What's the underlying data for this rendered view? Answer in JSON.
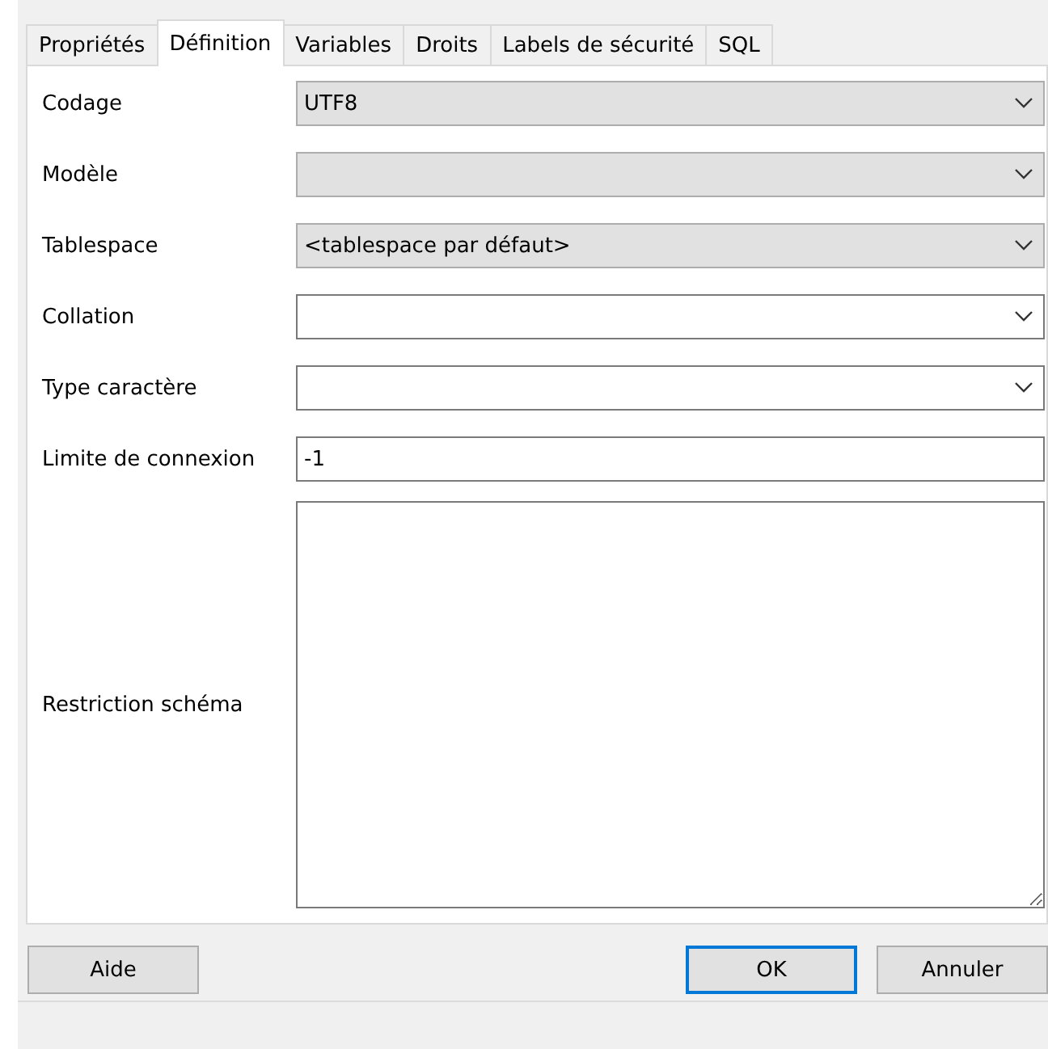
{
  "tabs": [
    {
      "label": "Propriétés",
      "selected": false
    },
    {
      "label": "Définition",
      "selected": true
    },
    {
      "label": "Variables",
      "selected": false
    },
    {
      "label": "Droits",
      "selected": false
    },
    {
      "label": "Labels de sécurité",
      "selected": false
    },
    {
      "label": "SQL",
      "selected": false
    }
  ],
  "fields": [
    {
      "label": "Codage",
      "kind": "combo",
      "editable": false,
      "value": "UTF8"
    },
    {
      "label": "Modèle",
      "kind": "combo",
      "editable": false
    },
    {
      "label": "Tablespace",
      "kind": "combo",
      "editable": false,
      "value": "<tablespace par défaut>"
    },
    {
      "label": "Collation",
      "kind": "combo",
      "editable": true
    },
    {
      "label": "Type caractère",
      "kind": "combo",
      "editable": true
    },
    {
      "label": "Limite de connexion",
      "kind": "text",
      "value": "-1"
    },
    {
      "label": "Restriction schéma",
      "kind": "textarea"
    }
  ],
  "buttons": [
    {
      "label": "Aide",
      "default": false
    },
    {
      "label": "OK",
      "default": true
    },
    {
      "label": "Annuler",
      "default": false
    }
  ]
}
